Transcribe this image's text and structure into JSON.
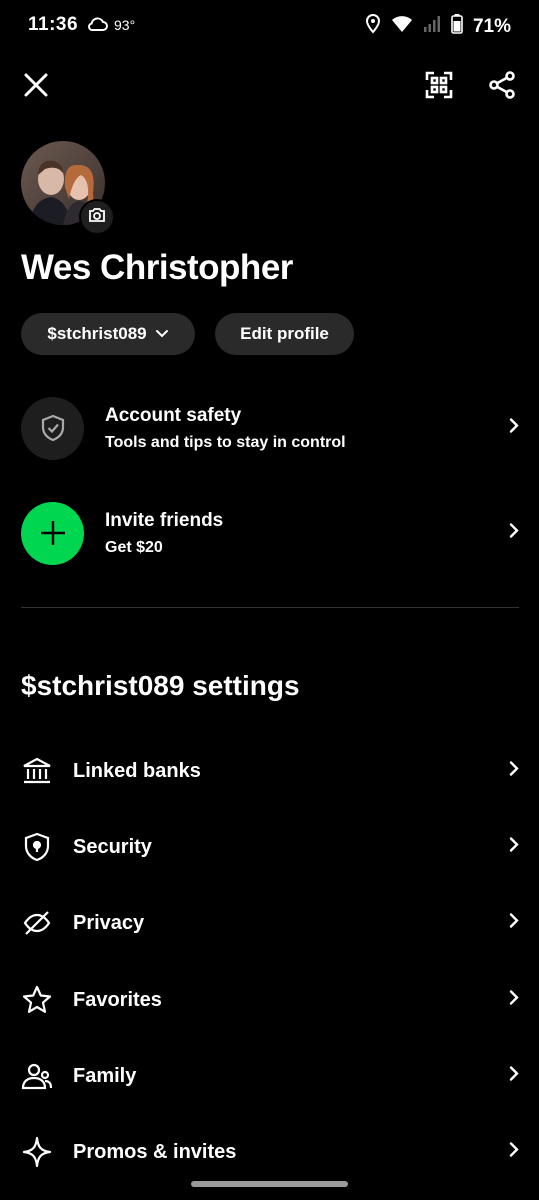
{
  "status_bar": {
    "time": "11:36",
    "temperature": "93°",
    "battery": "71%"
  },
  "profile": {
    "name": "Wes Christopher",
    "cashtag": "$stchrist089",
    "edit_label": "Edit profile"
  },
  "cards": [
    {
      "title": "Account safety",
      "subtitle": "Tools and tips to stay in control",
      "icon": "shield-check-icon"
    },
    {
      "title": "Invite friends",
      "subtitle": "Get $20",
      "icon": "plus-icon",
      "color": "#00d64f"
    }
  ],
  "settings": {
    "title": "$stchrist089 settings",
    "items": [
      {
        "label": "Linked banks",
        "icon": "bank-icon"
      },
      {
        "label": "Security",
        "icon": "shield-lock-icon"
      },
      {
        "label": "Privacy",
        "icon": "eye-slash-icon"
      },
      {
        "label": "Favorites",
        "icon": "star-icon"
      },
      {
        "label": "Family",
        "icon": "family-icon"
      },
      {
        "label": "Promos & invites",
        "icon": "sparkle-icon"
      }
    ]
  }
}
